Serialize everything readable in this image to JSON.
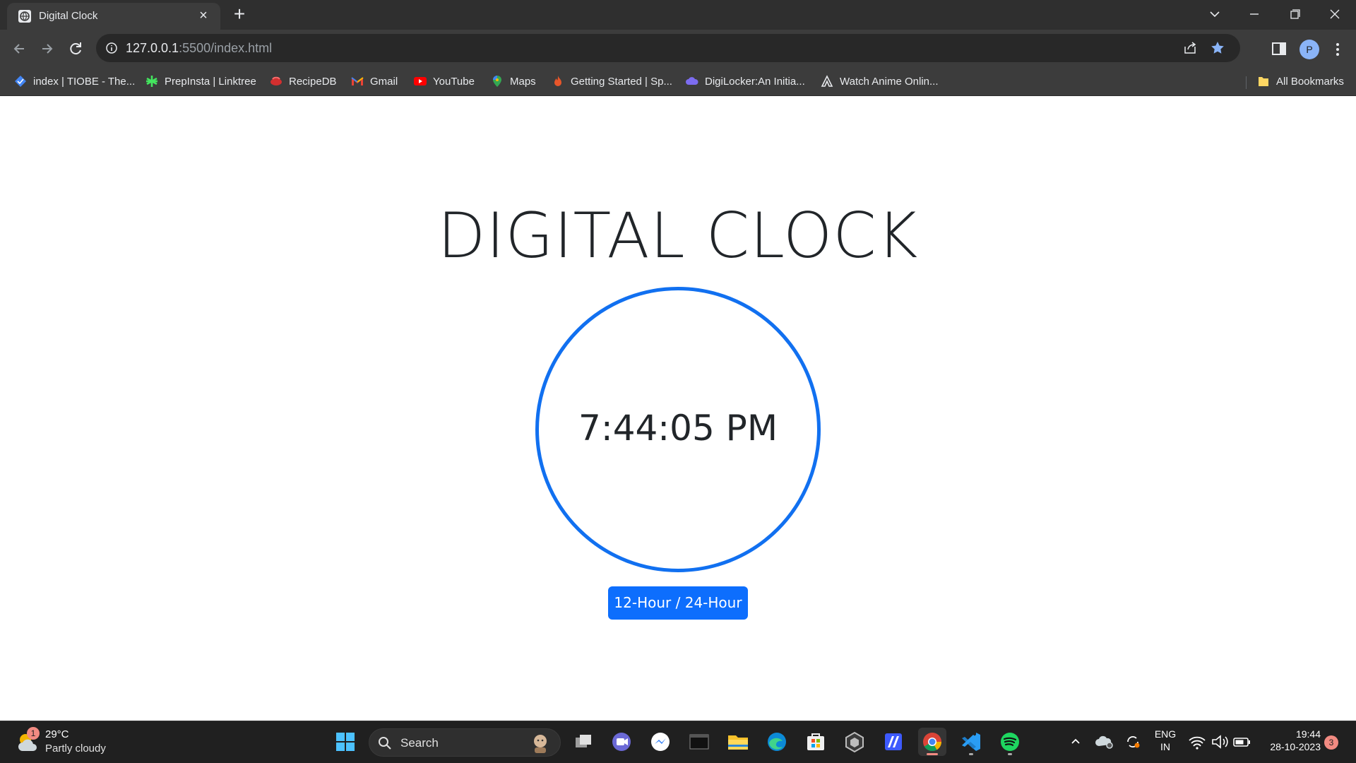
{
  "browser": {
    "tab_title": "Digital Clock",
    "url_host": "127.0.0.1",
    "url_rest": ":5500/index.html",
    "profile_initial": "P",
    "bookmarks": [
      {
        "label": "index | TIOBE - The..."
      },
      {
        "label": "PrepInsta | Linktree"
      },
      {
        "label": "RecipeDB"
      },
      {
        "label": "Gmail"
      },
      {
        "label": "YouTube"
      },
      {
        "label": "Maps"
      },
      {
        "label": "Getting Started | Sp..."
      },
      {
        "label": "DigiLocker:An Initia..."
      },
      {
        "label": "Watch Anime Onlin..."
      }
    ],
    "all_bookmarks_label": "All Bookmarks"
  },
  "page": {
    "title": "DIGITAL CLOCK",
    "time": "7:44:05 PM",
    "toggle_label": "12-Hour / 24-Hour",
    "accent_color": "#0d6efd"
  },
  "taskbar": {
    "weather_temp": "29°C",
    "weather_desc": "Partly cloudy",
    "weather_badge": "1",
    "search_label": "Search",
    "lang_line1": "ENG",
    "lang_line2": "IN",
    "time": "19:44",
    "date": "28-10-2023",
    "notification_count": "3"
  }
}
